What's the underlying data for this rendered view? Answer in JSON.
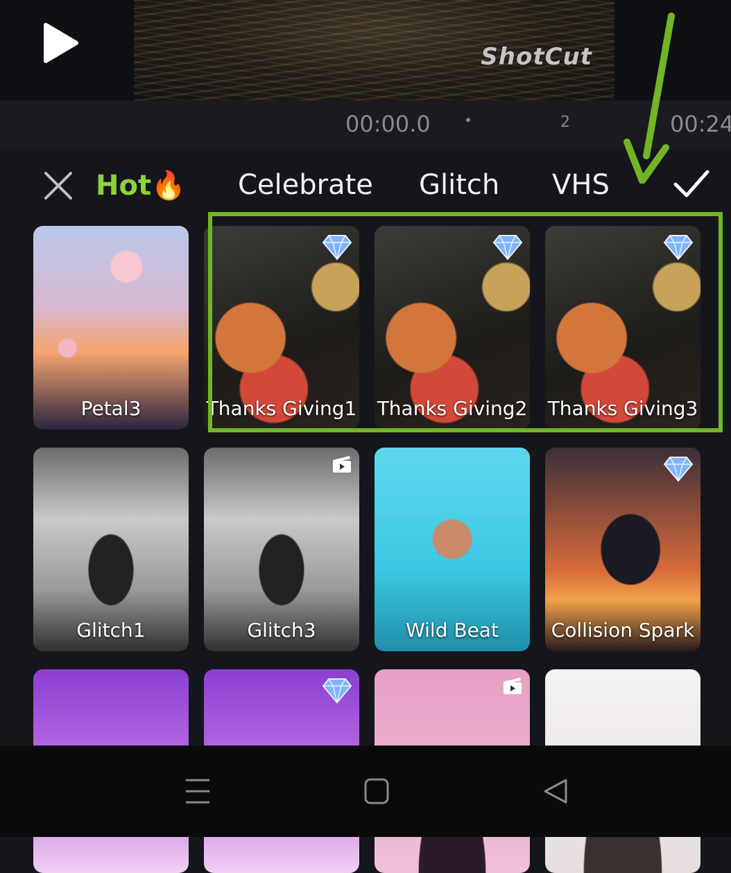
{
  "player": {
    "watermark": "ShotCut",
    "time_current": "00:00.0",
    "time_mark": "2",
    "time_end": "00:24"
  },
  "tabs": [
    {
      "label": "Hot🔥",
      "active": true
    },
    {
      "label": "Celebrate",
      "active": false
    },
    {
      "label": "Glitch",
      "active": false
    },
    {
      "label": "VHS",
      "active": false
    }
  ],
  "effects": [
    {
      "name": "Petal3",
      "badge": "none"
    },
    {
      "name": "Thanks Giving1",
      "badge": "diamond-icon"
    },
    {
      "name": "Thanks Giving2",
      "badge": "diamond-icon"
    },
    {
      "name": "Thanks Giving3",
      "badge": "diamond-icon"
    },
    {
      "name": "Glitch1",
      "badge": "none"
    },
    {
      "name": "Glitch3",
      "badge": "film-icon"
    },
    {
      "name": "Wild Beat",
      "badge": "none"
    },
    {
      "name": "Collision Spark",
      "badge": "diamond-icon"
    },
    {
      "name": "",
      "badge": "none"
    },
    {
      "name": "",
      "badge": "diamond-icon"
    },
    {
      "name": "",
      "badge": "film-icon"
    },
    {
      "name": "",
      "badge": "none"
    }
  ],
  "colors": {
    "accent_active_tab": "#8cd23c",
    "annotation": "#72b526",
    "background": "#15161b"
  }
}
